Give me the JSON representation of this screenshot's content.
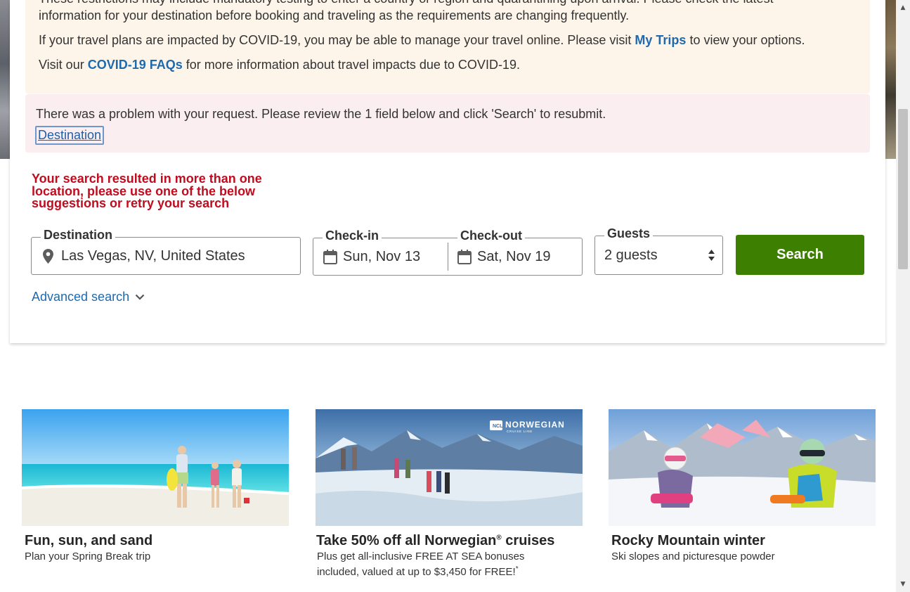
{
  "covid_notice": {
    "line1": "These restrictions may include mandatory testing to enter a country or region and quarantining upon arrival. Please check the latest",
    "line2": "information for your destination before booking and traveling as the requirements are changing frequently.",
    "line3_pre": "If your travel plans are impacted by COVID-19, you may be able to manage your travel online. Please visit ",
    "line3_link": "My Trips",
    "line3_post": " to view your options.",
    "line4_pre": "Visit our ",
    "line4_link": "COVID-19 FAQs",
    "line4_post": " for more information about travel impacts due to COVID-19."
  },
  "error_summary": {
    "message": "There was a problem with your request. Please review the 1 field below and click 'Search' to resubmit.",
    "field_link": "Destination"
  },
  "location_error": "Your search resulted in more than one location, please use one of the below suggestions or retry your search",
  "search_form": {
    "destination_label": "Destination",
    "destination_value": "Las Vegas, NV, United States",
    "checkin_label": "Check-in",
    "checkin_value": "Sun, Nov 13",
    "checkout_label": "Check-out",
    "checkout_value": "Sat, Nov 19",
    "guests_label": "Guests",
    "guests_value": "2 guests",
    "search_button": "Search",
    "advanced_search": "Advanced search"
  },
  "promos": [
    {
      "title": "Fun, sun, and sand",
      "subtitle": "Plan your Spring Break trip"
    },
    {
      "title_pre": "Take 50% off all Norwegian",
      "title_sup": "®",
      "title_post": " cruises",
      "subtitle_line1": "Plus get all-inclusive FREE AT SEA bonuses",
      "subtitle_line2": "included, valued at up to $3,450 for FREE!",
      "subtitle_sup": "*",
      "brand_line1": "NORWEGIAN",
      "brand_line2": "CRUISE LINE",
      "brand_badge": "NCL"
    },
    {
      "title": "Rocky Mountain winter",
      "subtitle": "Ski slopes and picturesque powder"
    }
  ],
  "colors": {
    "accent_link": "#1f69ad",
    "search_button": "#3d8001",
    "error_text": "#c00c1f",
    "covid_bg": "#fef5ea",
    "error_bg": "#fbeef0"
  }
}
